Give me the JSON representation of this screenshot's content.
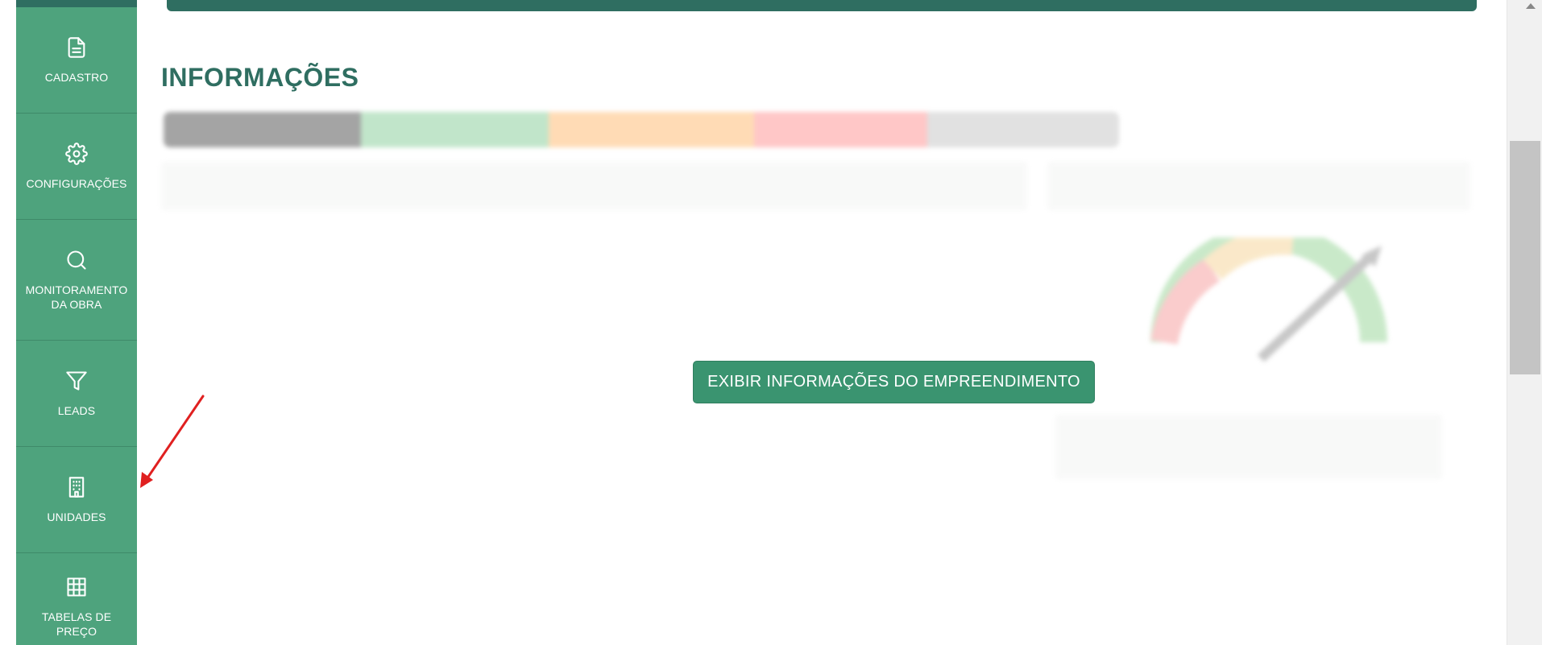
{
  "sidebar": {
    "items": [
      {
        "label": "CADASTRO",
        "icon": "file-text-icon"
      },
      {
        "label": "CONFIGURAÇÕES",
        "icon": "gear-icon"
      },
      {
        "label": "MONITORAMENTO DA OBRA",
        "icon": "search-icon"
      },
      {
        "label": "LEADS",
        "icon": "filter-icon"
      },
      {
        "label": "UNIDADES",
        "icon": "building-icon"
      },
      {
        "label": "TABELAS DE PREÇO",
        "icon": "grid-icon"
      }
    ]
  },
  "main": {
    "section_title": "INFORMAÇÕES",
    "cta_button": "EXIBIR INFORMAÇÕES DO EMPREENDIMENTO"
  },
  "colors": {
    "sidebar_bg": "#4ea37d",
    "accent_dark": "#2f6e61",
    "button_bg": "#3a9470",
    "annotation_arrow": "#e02020"
  }
}
